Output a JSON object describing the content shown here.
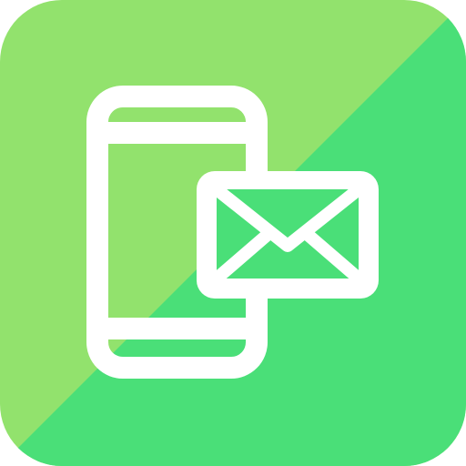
{
  "icon": {
    "name": "phone-message-icon",
    "colors": {
      "background_light": "#92E26D",
      "background_dark": "#4ADF78",
      "stroke": "#FFFFFF"
    }
  }
}
